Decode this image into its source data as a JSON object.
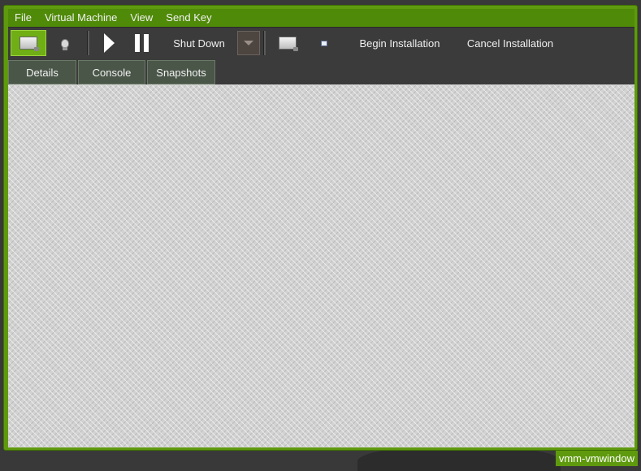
{
  "menubar": {
    "items": [
      "File",
      "Virtual Machine",
      "View",
      "Send Key"
    ]
  },
  "toolbar": {
    "shutdown_label": "Shut Down",
    "begin_install_label": "Begin Installation",
    "cancel_install_label": "Cancel Installation",
    "icons": [
      "monitor-icon",
      "bulb-icon",
      "play-icon",
      "pause-icon",
      "chevron-down-icon",
      "screenshot-icon",
      "small-icon"
    ]
  },
  "tabs": [
    {
      "label": "Details"
    },
    {
      "label": "Console"
    },
    {
      "label": "Snapshots"
    }
  ],
  "window": {
    "label": "vmm-vmwindow"
  },
  "colors": {
    "accent": "#5f9a0e",
    "toolbar_bg": "#3b3b3b",
    "content_bg": "#d2d2d2"
  }
}
